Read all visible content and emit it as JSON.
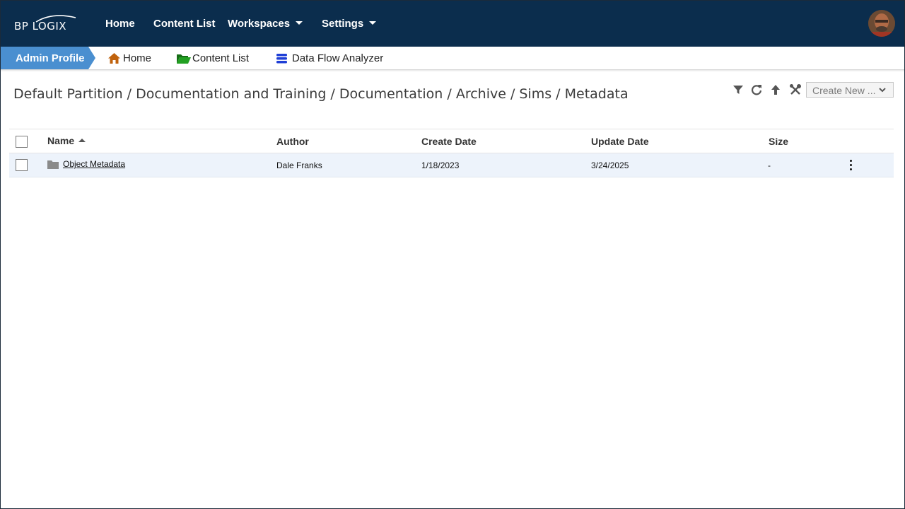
{
  "brand": {
    "logo_text": "BP LOGIX"
  },
  "topnav": {
    "items": [
      {
        "label": "Home",
        "has_dropdown": false
      },
      {
        "label": "Content List",
        "has_dropdown": false
      },
      {
        "label": "Workspaces",
        "has_dropdown": true
      },
      {
        "label": "Settings",
        "has_dropdown": true
      }
    ]
  },
  "tabbar": {
    "profile": "Admin Profile",
    "links": [
      {
        "label": "Home",
        "icon": "home-icon"
      },
      {
        "label": "Content List",
        "icon": "folder-open-icon"
      },
      {
        "label": "Data Flow Analyzer",
        "icon": "database-icon"
      }
    ]
  },
  "path": {
    "text": "Default Partition / Documentation and Training / Documentation / Archive / Sims / Metadata"
  },
  "toolbar": {
    "icons": [
      "filter-icon",
      "refresh-icon",
      "up-arrow-icon",
      "tools-icon"
    ],
    "create_new": "Create New ..."
  },
  "table": {
    "headers": {
      "name": "Name",
      "author": "Author",
      "create_date": "Create Date",
      "update_date": "Update Date",
      "size": "Size"
    },
    "sort": {
      "column": "Name",
      "direction": "ascending"
    },
    "rows": [
      {
        "name": "Object Metadata",
        "type": "folder",
        "author": "Dale Franks",
        "create_date": "1/18/2023",
        "update_date": "3/24/2025",
        "size": "-"
      }
    ]
  },
  "colors": {
    "nav_bg": "#0b2d4d",
    "profile_tab": "#4a8fd0",
    "row_bg": "#edf3fb",
    "home_icon": "#c0620c",
    "folder_icon": "#1e8a1e",
    "db_icon": "#1f3fd6"
  }
}
